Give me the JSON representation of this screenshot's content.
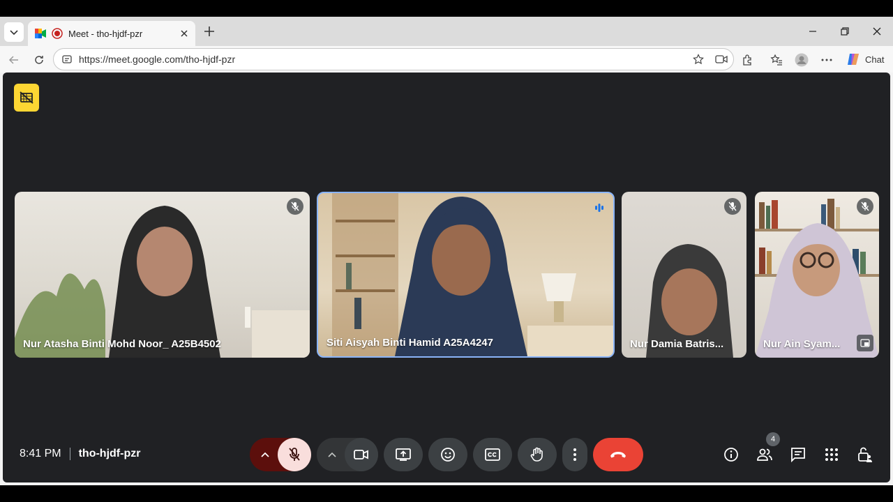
{
  "browser": {
    "tab_title": "Meet - tho-hjdf-pzr",
    "url": "https://meet.google.com/tho-hjdf-pzr",
    "chat_label": "Chat"
  },
  "meet": {
    "time": "8:41 PM",
    "meeting_code": "tho-hjdf-pzr",
    "participant_count": "4",
    "tiles": [
      {
        "name": "Nur Atasha Binti Mohd Noor_ A25B4502",
        "muted": true
      },
      {
        "name": "Siti Aisyah Binti Hamid A25A4247",
        "muted": false,
        "speaking": true
      },
      {
        "name": "Nur Damia Batris...",
        "muted": true
      },
      {
        "name": "Nur Ain Syam...",
        "muted": true
      }
    ]
  },
  "colors": {
    "meet_bg": "#202124",
    "end_call": "#ea4335",
    "mic_off_bg": "#f9dedc",
    "recording_badge": "#fdd633",
    "active_tile_border": "#8ab4f8"
  }
}
